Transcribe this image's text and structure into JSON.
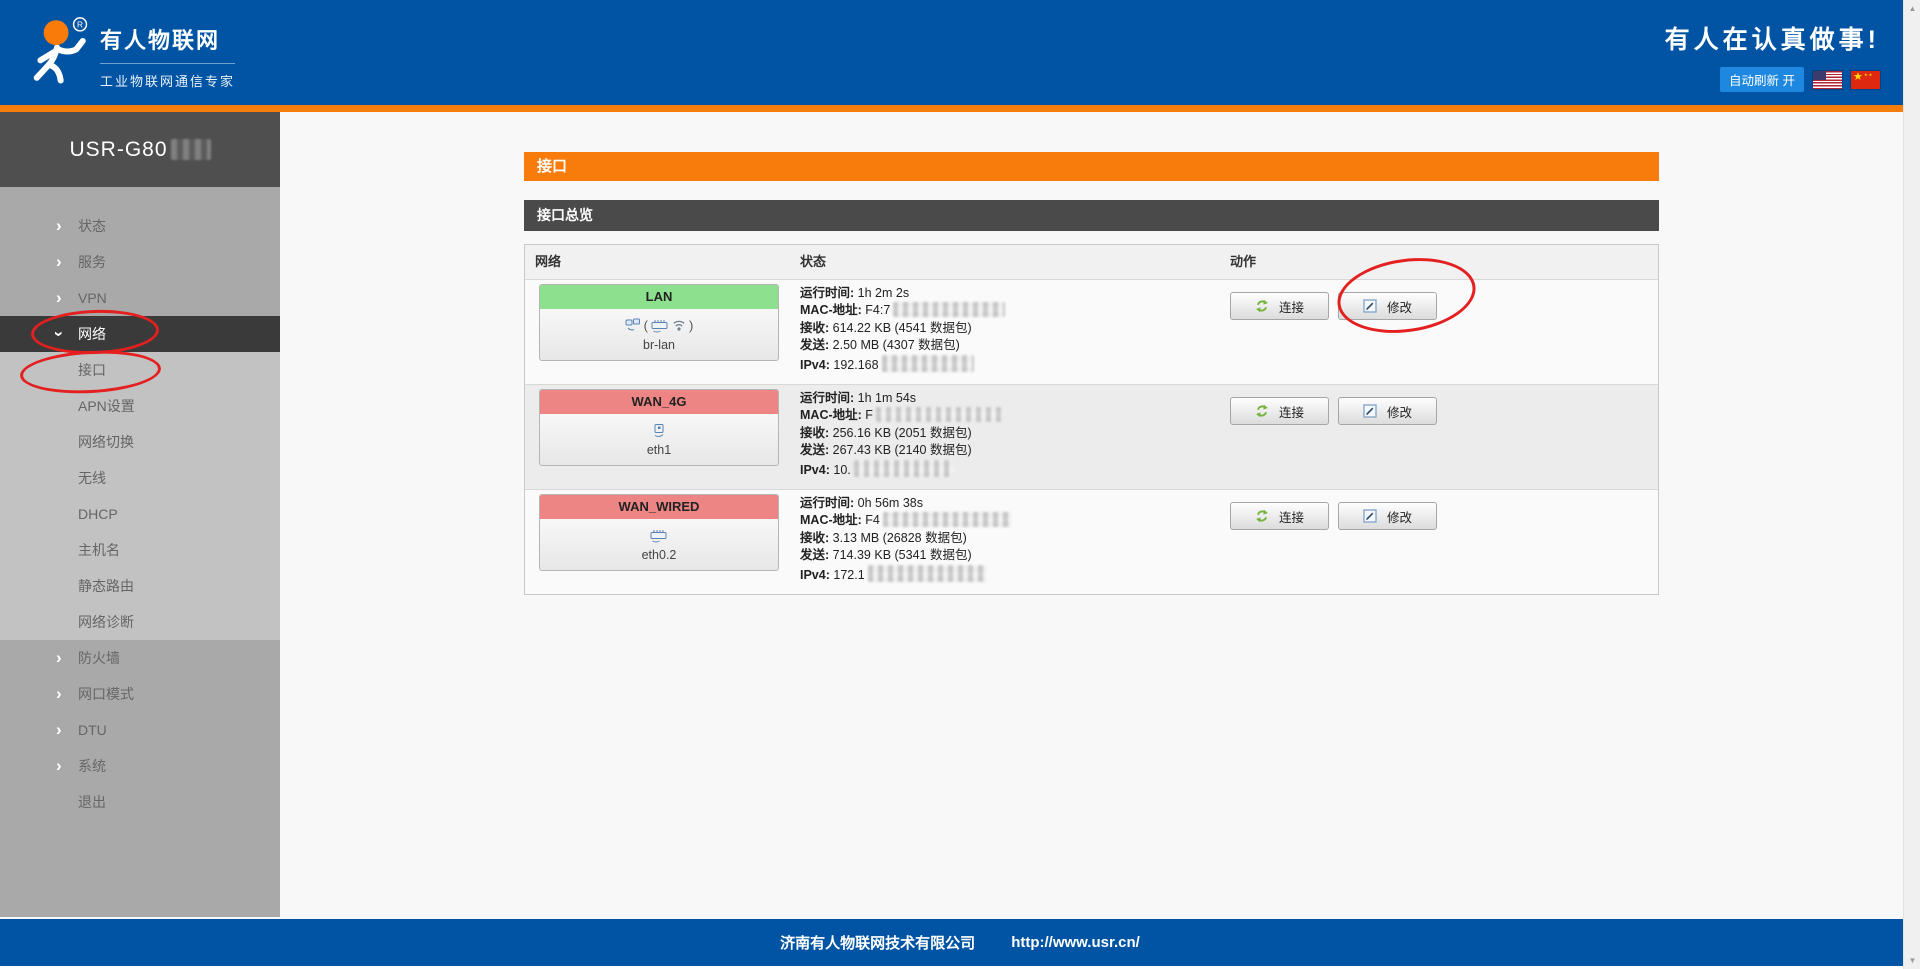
{
  "colors": {
    "header_blue": "#0054a3",
    "accent_orange": "#f87c0b",
    "auto_refresh_blue": "#1e87e0",
    "sidebar_gray": "#a9a9a9",
    "submenu_gray": "#c2c2c2",
    "active_item_dark": "#3a3a3a",
    "section_bar_dark": "#4a4a4a",
    "lan_green": "#8de08d",
    "wan_red": "#ee8585",
    "annotation_red": "#e41f1f"
  },
  "icons": {
    "chevron_right": "›",
    "scroll_up": "▲",
    "scroll_down": "▼",
    "reg_mark": "®"
  },
  "header": {
    "brand_title": "有人物联网",
    "brand_subtitle": "工业物联网通信专家",
    "slogan": "有人在认真做事!",
    "auto_refresh": "自动刷新 开"
  },
  "sidebar": {
    "device_title": "USR-G80",
    "items": [
      {
        "label": "状态",
        "type": "top"
      },
      {
        "label": "服务",
        "type": "top"
      },
      {
        "label": "VPN",
        "type": "top"
      },
      {
        "label": "网络",
        "type": "top",
        "active": true,
        "circled": true
      },
      {
        "label": "接口",
        "type": "sub",
        "circled": true
      },
      {
        "label": "APN设置",
        "type": "sub"
      },
      {
        "label": "网络切换",
        "type": "sub"
      },
      {
        "label": "无线",
        "type": "sub"
      },
      {
        "label": "DHCP",
        "type": "sub"
      },
      {
        "label": "主机名",
        "type": "sub"
      },
      {
        "label": "静态路由",
        "type": "sub"
      },
      {
        "label": "网络诊断",
        "type": "sub"
      },
      {
        "label": "防火墙",
        "type": "top"
      },
      {
        "label": "网口模式",
        "type": "top"
      },
      {
        "label": "DTU",
        "type": "top"
      },
      {
        "label": "系统",
        "type": "top"
      },
      {
        "label": "退出",
        "type": "top",
        "no_arrow": true
      }
    ]
  },
  "main": {
    "page_title": "接口",
    "section_title": "接口总览",
    "table": {
      "columns": [
        "网络",
        "状态",
        "动作"
      ],
      "actions": {
        "connect": "连接",
        "edit": "修改"
      },
      "rows": [
        {
          "name": "LAN",
          "device": "br-lan",
          "paren_open": "(",
          "paren_close": ")",
          "uptime_label": "运行时间:",
          "uptime": "1h 2m 2s",
          "mac_label": "MAC-地址:",
          "mac_prefix": "F4:7",
          "rx_label": "接收:",
          "rx": "614.22 KB (4541 数据包)",
          "tx_label": "发送:",
          "tx": "2.50 MB (4307 数据包)",
          "ip_label": "IPv4:",
          "ip_prefix": "192.168"
        },
        {
          "name": "WAN_4G",
          "device": "eth1",
          "uptime_label": "运行时间:",
          "uptime": "1h 1m 54s",
          "mac_label": "MAC-地址:",
          "mac_prefix": "F",
          "rx_label": "接收:",
          "rx": "256.16 KB (2051 数据包)",
          "tx_label": "发送:",
          "tx": "267.43 KB (2140 数据包)",
          "ip_label": "IPv4:",
          "ip_prefix": "10."
        },
        {
          "name": "WAN_WIRED",
          "device": "eth0.2",
          "uptime_label": "运行时间:",
          "uptime": "0h 56m 38s",
          "mac_label": "MAC-地址:",
          "mac_prefix": "F4",
          "rx_label": "接收:",
          "rx": "3.13 MB (26828 数据包)",
          "tx_label": "发送:",
          "tx": "714.39 KB (5341 数据包)",
          "ip_label": "IPv4:",
          "ip_prefix": "172.1"
        }
      ]
    }
  },
  "footer": {
    "company": "济南有人物联网技术有限公司",
    "url": "http://www.usr.cn/"
  }
}
